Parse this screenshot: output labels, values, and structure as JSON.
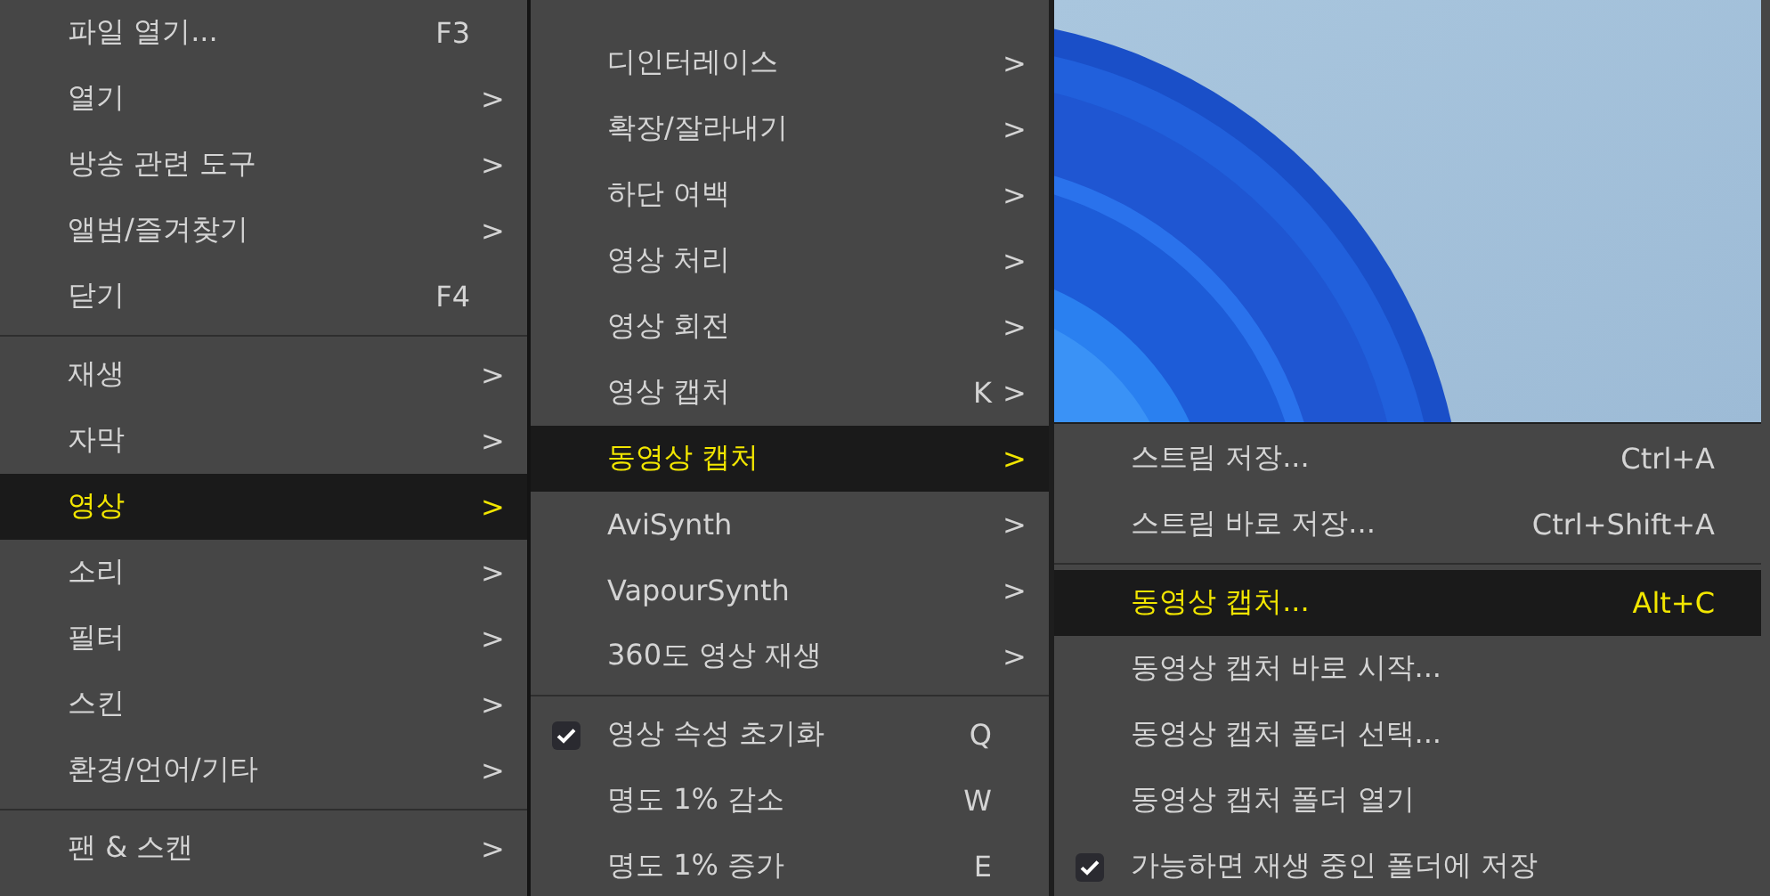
{
  "menus": [
    {
      "items": [
        {
          "kind": "item",
          "label": "파일 열기...",
          "shortcut": "F3",
          "selected": false,
          "checked": false
        },
        {
          "kind": "item",
          "label": "열기",
          "arrow": ">",
          "selected": false,
          "checked": false
        },
        {
          "kind": "item",
          "label": "방송 관련 도구",
          "arrow": ">",
          "selected": false,
          "checked": false
        },
        {
          "kind": "item",
          "label": "앨범/즐겨찾기",
          "arrow": ">",
          "selected": false,
          "checked": false
        },
        {
          "kind": "item",
          "label": "닫기",
          "shortcut": "F4",
          "selected": false,
          "checked": false
        },
        {
          "kind": "separator"
        },
        {
          "kind": "item",
          "label": "재생",
          "arrow": ">",
          "selected": false,
          "checked": false
        },
        {
          "kind": "item",
          "label": "자막",
          "arrow": ">",
          "selected": false,
          "checked": false
        },
        {
          "kind": "item",
          "label": "영상",
          "arrow": ">",
          "selected": true,
          "checked": false
        },
        {
          "kind": "item",
          "label": "소리",
          "arrow": ">",
          "selected": false,
          "checked": false
        },
        {
          "kind": "item",
          "label": "필터",
          "arrow": ">",
          "selected": false,
          "checked": false
        },
        {
          "kind": "item",
          "label": "스킨",
          "arrow": ">",
          "selected": false,
          "checked": false
        },
        {
          "kind": "item",
          "label": "환경/언어/기타",
          "arrow": ">",
          "selected": false,
          "checked": false
        },
        {
          "kind": "separator"
        },
        {
          "kind": "item",
          "label": "팬 & 스캔",
          "arrow": ">",
          "selected": false,
          "checked": false
        }
      ]
    },
    {
      "items": [
        {
          "kind": "item",
          "label": "디인터레이스",
          "arrow": ">",
          "selected": false,
          "checked": false
        },
        {
          "kind": "item",
          "label": "확장/잘라내기",
          "arrow": ">",
          "selected": false,
          "checked": false
        },
        {
          "kind": "item",
          "label": "하단 여백",
          "arrow": ">",
          "selected": false,
          "checked": false
        },
        {
          "kind": "item",
          "label": "영상 처리",
          "arrow": ">",
          "selected": false,
          "checked": false
        },
        {
          "kind": "item",
          "label": "영상 회전",
          "arrow": ">",
          "selected": false,
          "checked": false
        },
        {
          "kind": "item",
          "label": "영상 캡처",
          "shortcut": "K",
          "arrow": ">",
          "selected": false,
          "checked": false
        },
        {
          "kind": "item",
          "label": "동영상 캡처",
          "arrow": ">",
          "selected": true,
          "checked": false
        },
        {
          "kind": "item",
          "label": "AviSynth",
          "arrow": ">",
          "selected": false,
          "checked": false
        },
        {
          "kind": "item",
          "label": "VapourSynth",
          "arrow": ">",
          "selected": false,
          "checked": false
        },
        {
          "kind": "item",
          "label": "360도 영상 재생",
          "arrow": ">",
          "selected": false,
          "checked": false
        },
        {
          "kind": "separator"
        },
        {
          "kind": "item",
          "label": "영상 속성 초기화",
          "shortcut": "Q",
          "selected": false,
          "checked": true
        },
        {
          "kind": "item",
          "label": "명도 1% 감소",
          "shortcut": "W",
          "selected": false,
          "checked": false
        },
        {
          "kind": "item",
          "label": "명도 1% 증가",
          "shortcut": "E",
          "selected": false,
          "checked": false
        }
      ]
    },
    {
      "items": [
        {
          "kind": "item",
          "label": "스트림 저장...",
          "shortcut": "Ctrl+A",
          "selected": false,
          "checked": false
        },
        {
          "kind": "item",
          "label": "스트림 바로 저장...",
          "shortcut": "Ctrl+Shift+A",
          "selected": false,
          "checked": false
        },
        {
          "kind": "separator"
        },
        {
          "kind": "item",
          "label": "동영상 캡처...",
          "shortcut": "Alt+C",
          "selected": true,
          "checked": false
        },
        {
          "kind": "item",
          "label": "동영상 캡처 바로 시작...",
          "selected": false,
          "checked": false
        },
        {
          "kind": "item",
          "label": "동영상 캡처 폴더 선택...",
          "selected": false,
          "checked": false
        },
        {
          "kind": "item",
          "label": "동영상 캡처 폴더 열기",
          "selected": false,
          "checked": false
        },
        {
          "kind": "item",
          "label": "가능하면 재생 중인 폴더에 저장",
          "selected": false,
          "checked": true
        }
      ]
    }
  ]
}
